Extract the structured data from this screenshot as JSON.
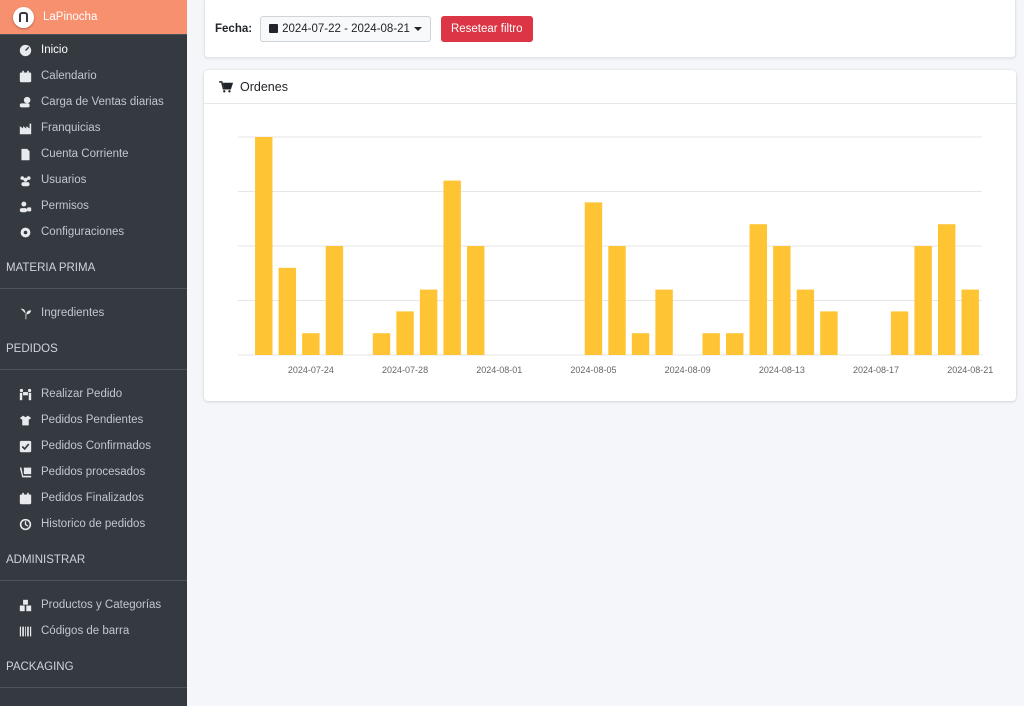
{
  "sidebar": {
    "brand": "LaPinocha",
    "items": [
      {
        "label": "Inicio",
        "icon": "dashboard-icon",
        "active": true
      },
      {
        "label": "Calendario",
        "icon": "calendar-icon"
      },
      {
        "label": "Carga de Ventas diarias",
        "icon": "money-hand-icon"
      },
      {
        "label": "Franquicias",
        "icon": "industry-icon"
      },
      {
        "label": "Cuenta Corriente",
        "icon": "file-invoice-icon"
      },
      {
        "label": "Usuarios",
        "icon": "users-icon"
      },
      {
        "label": "Permisos",
        "icon": "user-lock-icon"
      },
      {
        "label": "Configuraciones",
        "icon": "gear-icon"
      }
    ],
    "sections": [
      {
        "title": "MATERIA PRIMA",
        "items": [
          {
            "label": "Ingredientes",
            "icon": "seedling-icon"
          }
        ]
      },
      {
        "title": "PEDIDOS",
        "items": [
          {
            "label": "Realizar Pedido",
            "icon": "people-carry-icon"
          },
          {
            "label": "Pedidos Pendientes",
            "icon": "box-open-icon"
          },
          {
            "label": "Pedidos Confirmados",
            "icon": "check-square-icon"
          },
          {
            "label": "Pedidos procesados",
            "icon": "dolly-icon"
          },
          {
            "label": "Pedidos Finalizados",
            "icon": "calendar-check-icon"
          },
          {
            "label": "Historico de pedidos",
            "icon": "history-icon"
          }
        ]
      },
      {
        "title": "ADMINISTRAR",
        "items": [
          {
            "label": "Productos y Categorías",
            "icon": "boxes-icon"
          },
          {
            "label": "Códigos de barra",
            "icon": "barcode-icon"
          }
        ]
      },
      {
        "title": "PACKAGING",
        "items": []
      }
    ]
  },
  "filter": {
    "label": "Fecha:",
    "date_range": "2024-07-22 - 2024-08-21",
    "reset_label": "Resetear filtro"
  },
  "card": {
    "title": "Ordenes",
    "icon": "shopping-cart-icon"
  },
  "colors": {
    "sidebar_bg": "#343a40",
    "brand_bg": "#f7906f",
    "bar": "#ffc433",
    "danger": "#dc3545"
  },
  "chart_data": {
    "type": "bar",
    "x_tick_labels": [
      "2024-07-24",
      "2024-07-28",
      "2024-08-01",
      "2024-08-05",
      "2024-08-09",
      "2024-08-13",
      "2024-08-17",
      "2024-08-21"
    ],
    "ylim": [
      0,
      10
    ],
    "y_tick_count": 5,
    "grid": true,
    "categories": [
      "2024-07-22",
      "2024-07-23",
      "2024-07-24",
      "2024-07-25",
      "2024-07-26",
      "2024-07-27",
      "2024-07-28",
      "2024-07-29",
      "2024-07-30",
      "2024-07-31",
      "2024-08-01",
      "2024-08-02",
      "2024-08-03",
      "2024-08-04",
      "2024-08-05",
      "2024-08-06",
      "2024-08-07",
      "2024-08-08",
      "2024-08-09",
      "2024-08-10",
      "2024-08-11",
      "2024-08-12",
      "2024-08-13",
      "2024-08-14",
      "2024-08-15",
      "2024-08-16",
      "2024-08-17",
      "2024-08-18",
      "2024-08-19",
      "2024-08-20",
      "2024-08-21"
    ],
    "values": [
      10,
      4,
      1,
      5,
      0,
      1,
      2,
      3,
      8,
      5,
      0,
      0,
      0,
      0,
      7,
      5,
      1,
      3,
      0,
      1,
      1,
      6,
      5,
      3,
      2,
      0,
      0,
      2,
      5,
      6,
      3
    ]
  }
}
